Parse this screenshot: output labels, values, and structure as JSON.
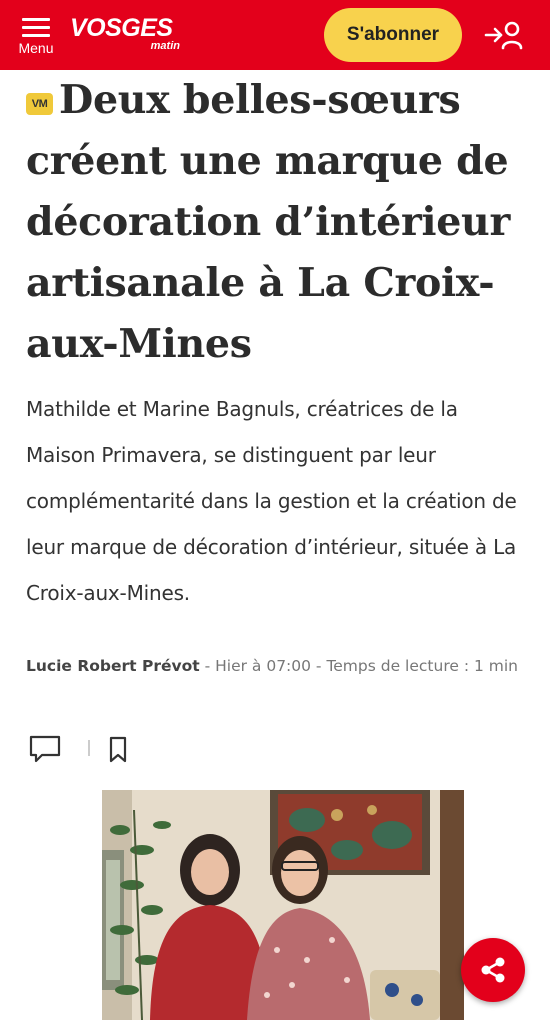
{
  "header": {
    "menu_label": "Menu",
    "logo_main": "VOSGES",
    "logo_sub": "matin",
    "subscribe_label": "S'abonner",
    "brand_color": "#e3001b",
    "subscribe_color": "#f8d24d"
  },
  "article": {
    "badge": "VM",
    "title": "Deux belles-sœurs créent une marque de décoration d’intérieur artisanale à La Croix-aux-Mines",
    "lead": "Mathilde et Marine Bagnuls, créatrices de la Maison Primavera, se distinguent par leur complémentarité dans la gestion et la création de leur marque de décoration d’intérieur, située à La Croix-aux-Mines.",
    "author": "Lucie Robert Prévot",
    "meta": " - Hier à 07:00 - Temps de lecture : 1 min"
  },
  "icons": {
    "menu": "hamburger-icon",
    "login": "login-user-icon",
    "comment": "comment-icon",
    "bookmark": "bookmark-icon",
    "share": "share-icon"
  }
}
